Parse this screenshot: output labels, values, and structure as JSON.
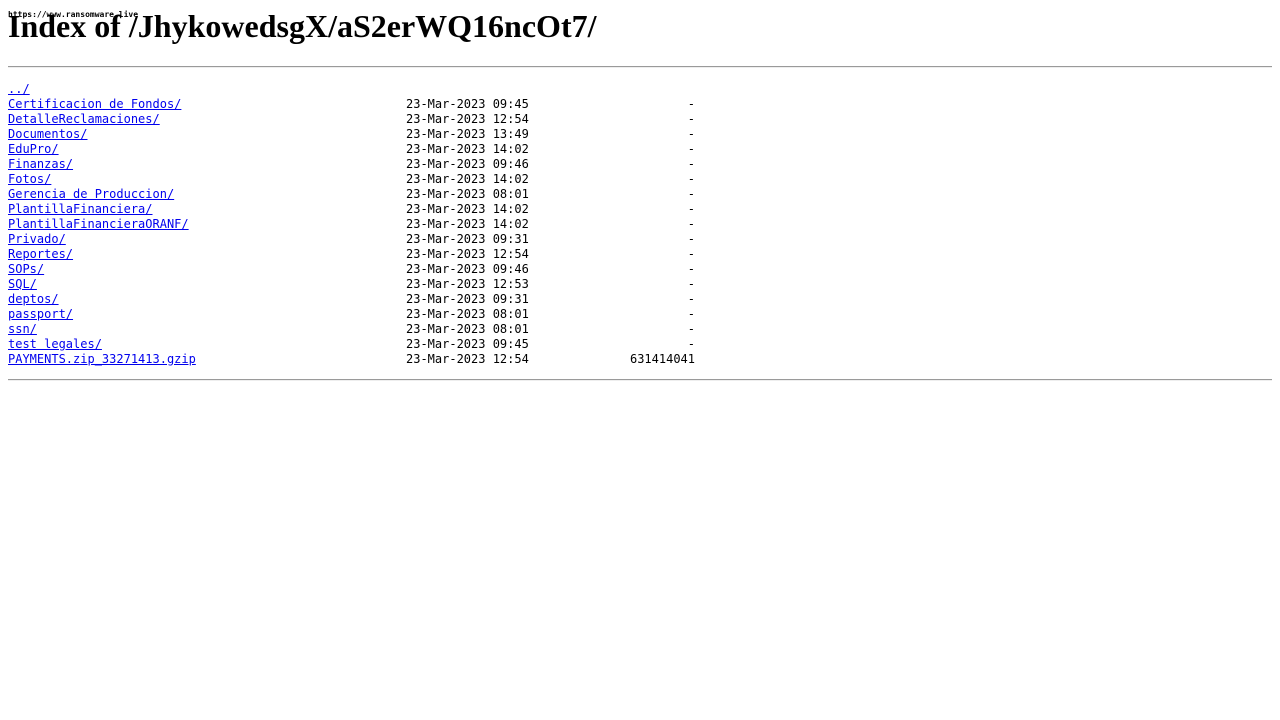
{
  "watermark": "https://www.ransomware.live",
  "page_title": "Index of /JhykowedsgX/aS2erWQ16ncOt7/",
  "parent_link": "../",
  "entries": [
    {
      "name": "Certificacion de Fondos/",
      "date": "23-Mar-2023 09:45",
      "size": "-"
    },
    {
      "name": "DetalleReclamaciones/",
      "date": "23-Mar-2023 12:54",
      "size": "-"
    },
    {
      "name": "Documentos/",
      "date": "23-Mar-2023 13:49",
      "size": "-"
    },
    {
      "name": "EduPro/",
      "date": "23-Mar-2023 14:02",
      "size": "-"
    },
    {
      "name": "Finanzas/",
      "date": "23-Mar-2023 09:46",
      "size": "-"
    },
    {
      "name": "Fotos/",
      "date": "23-Mar-2023 14:02",
      "size": "-"
    },
    {
      "name": "Gerencia de Produccion/",
      "date": "23-Mar-2023 08:01",
      "size": "-"
    },
    {
      "name": "PlantillaFinanciera/",
      "date": "23-Mar-2023 14:02",
      "size": "-"
    },
    {
      "name": "PlantillaFinancieraORANF/",
      "date": "23-Mar-2023 14:02",
      "size": "-"
    },
    {
      "name": "Privado/",
      "date": "23-Mar-2023 09:31",
      "size": "-"
    },
    {
      "name": "Reportes/",
      "date": "23-Mar-2023 12:54",
      "size": "-"
    },
    {
      "name": "SOPs/",
      "date": "23-Mar-2023 09:46",
      "size": "-"
    },
    {
      "name": "SQL/",
      "date": "23-Mar-2023 12:53",
      "size": "-"
    },
    {
      "name": "deptos/",
      "date": "23-Mar-2023 09:31",
      "size": "-"
    },
    {
      "name": "passport/",
      "date": "23-Mar-2023 08:01",
      "size": "-"
    },
    {
      "name": "ssn/",
      "date": "23-Mar-2023 08:01",
      "size": "-"
    },
    {
      "name": "test legales/",
      "date": "23-Mar-2023 09:45",
      "size": "-"
    },
    {
      "name": "PAYMENTS.zip_33271413.gzip",
      "date": "23-Mar-2023 12:54",
      "size": "631414041"
    }
  ],
  "colors": {
    "link": "#0000ee",
    "text": "#000000",
    "background": "#ffffff",
    "rule": "#9a9a9a"
  }
}
